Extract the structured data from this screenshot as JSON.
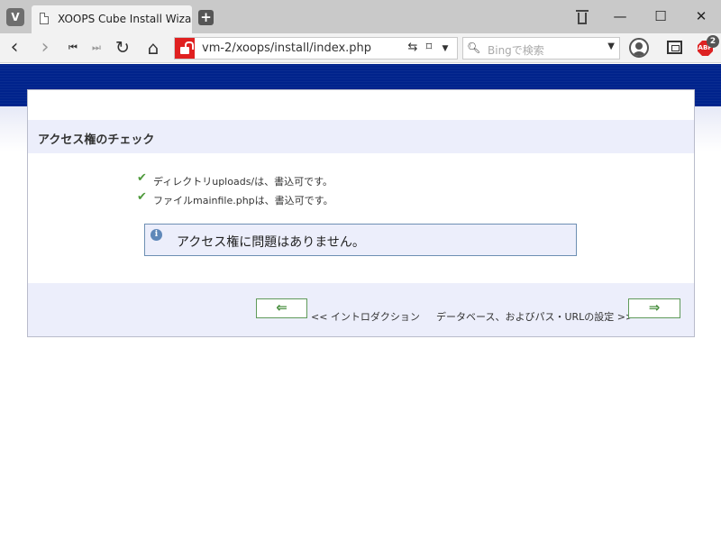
{
  "browser": {
    "app_icon": "V",
    "tab_title": "XOOPS Cube Install Wizard",
    "new_tab": "+",
    "window_controls": {
      "minimize": "—",
      "maximize": "☐",
      "close": "✕"
    },
    "nav": {
      "back": "‹",
      "forward": "›",
      "rewind": "⏮",
      "fastforward": "⏭",
      "reload": "↻",
      "home": "⌂"
    },
    "url": "vm-2/xoops/install/index.php",
    "search_placeholder": "Bingで検索",
    "extension_label": "ABP",
    "extension_badge": "2",
    "icons": [
      "page-icon",
      "trash-icon",
      "lock-icon",
      "reader-icon",
      "bookmark-icon",
      "search-icon",
      "avatar-icon",
      "capture-icon",
      "adblock-icon"
    ]
  },
  "wizard": {
    "title": "アクセス権のチェック",
    "checks": [
      "ディレクトリuploads/は、書込可です。",
      "ファイルmainfile.phpは、書込可です。"
    ],
    "notice": "アクセス権に問題はありません。",
    "back_arrow": "⇐",
    "next_arrow": "⇒",
    "back_label": "<< イントロダクション",
    "next_label": "データベース、およびパス・URLの設定 >>",
    "colors": {
      "banner": "#00238c",
      "panel": "#eceefb",
      "check": "#4f9a3c",
      "info": "#5f88b9"
    }
  }
}
